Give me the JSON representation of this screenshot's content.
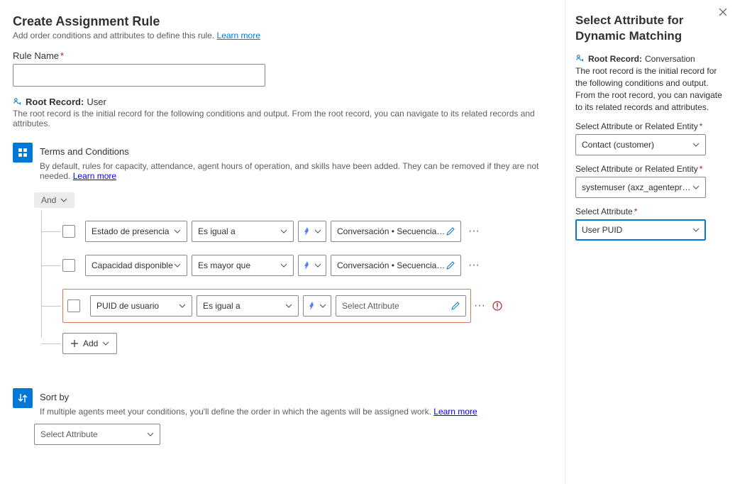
{
  "main": {
    "title": "Create Assignment Rule",
    "subtitle_text": "Add order conditions and attributes to define this rule. ",
    "subtitle_link": "Learn more",
    "rule_name_label": "Rule Name",
    "rule_name_value": "",
    "root_record_label": "Root Record:",
    "root_record_value": "User",
    "root_record_desc": "The root record is the initial record for the following conditions and output. From the root record, you can navigate to its related records and attributes."
  },
  "terms": {
    "title": "Terms and Conditions",
    "desc_text": "By default, rules for capacity, attendance, agent hours of operation, and skills have been added. They can be removed if they are not needed. ",
    "desc_link": "Learn more",
    "andor": "And",
    "rows": [
      {
        "attr": "Estado de presencia",
        "op": "Es igual a",
        "value": "Conversación • Secuencia de tra..."
      },
      {
        "attr": "Capacidad disponible",
        "op": "Es mayor que",
        "value": "Conversación • Secuencia de tra..."
      },
      {
        "attr": "PUID de usuario",
        "op": "Es igual a",
        "value": "",
        "placeholder": "Select Attribute"
      }
    ],
    "add_label": "Add"
  },
  "sortby": {
    "title": "Sort by",
    "desc_text": "If multiple agents meet your conditions, you'll define the order in which the agents will be assigned work. ",
    "desc_link": "Learn more",
    "placeholder": "Select Attribute"
  },
  "panel": {
    "title": "Select Attribute for Dynamic Matching",
    "root_record_label": "Root Record:",
    "root_record_value": "Conversation",
    "desc": "The root record is the initial record for the following conditions and output. From the root record, you can navigate to its related records and attributes.",
    "fields": [
      {
        "label": "Select Attribute or Related Entity",
        "required": true,
        "value": "Contact (customer)"
      },
      {
        "label": "Select Attribute or Related Entity",
        "required": true,
        "value": "systemuser (axz_agentepreferid..."
      },
      {
        "label": "Select Attribute",
        "required": true,
        "value": "User PUID",
        "focused": true
      }
    ]
  }
}
